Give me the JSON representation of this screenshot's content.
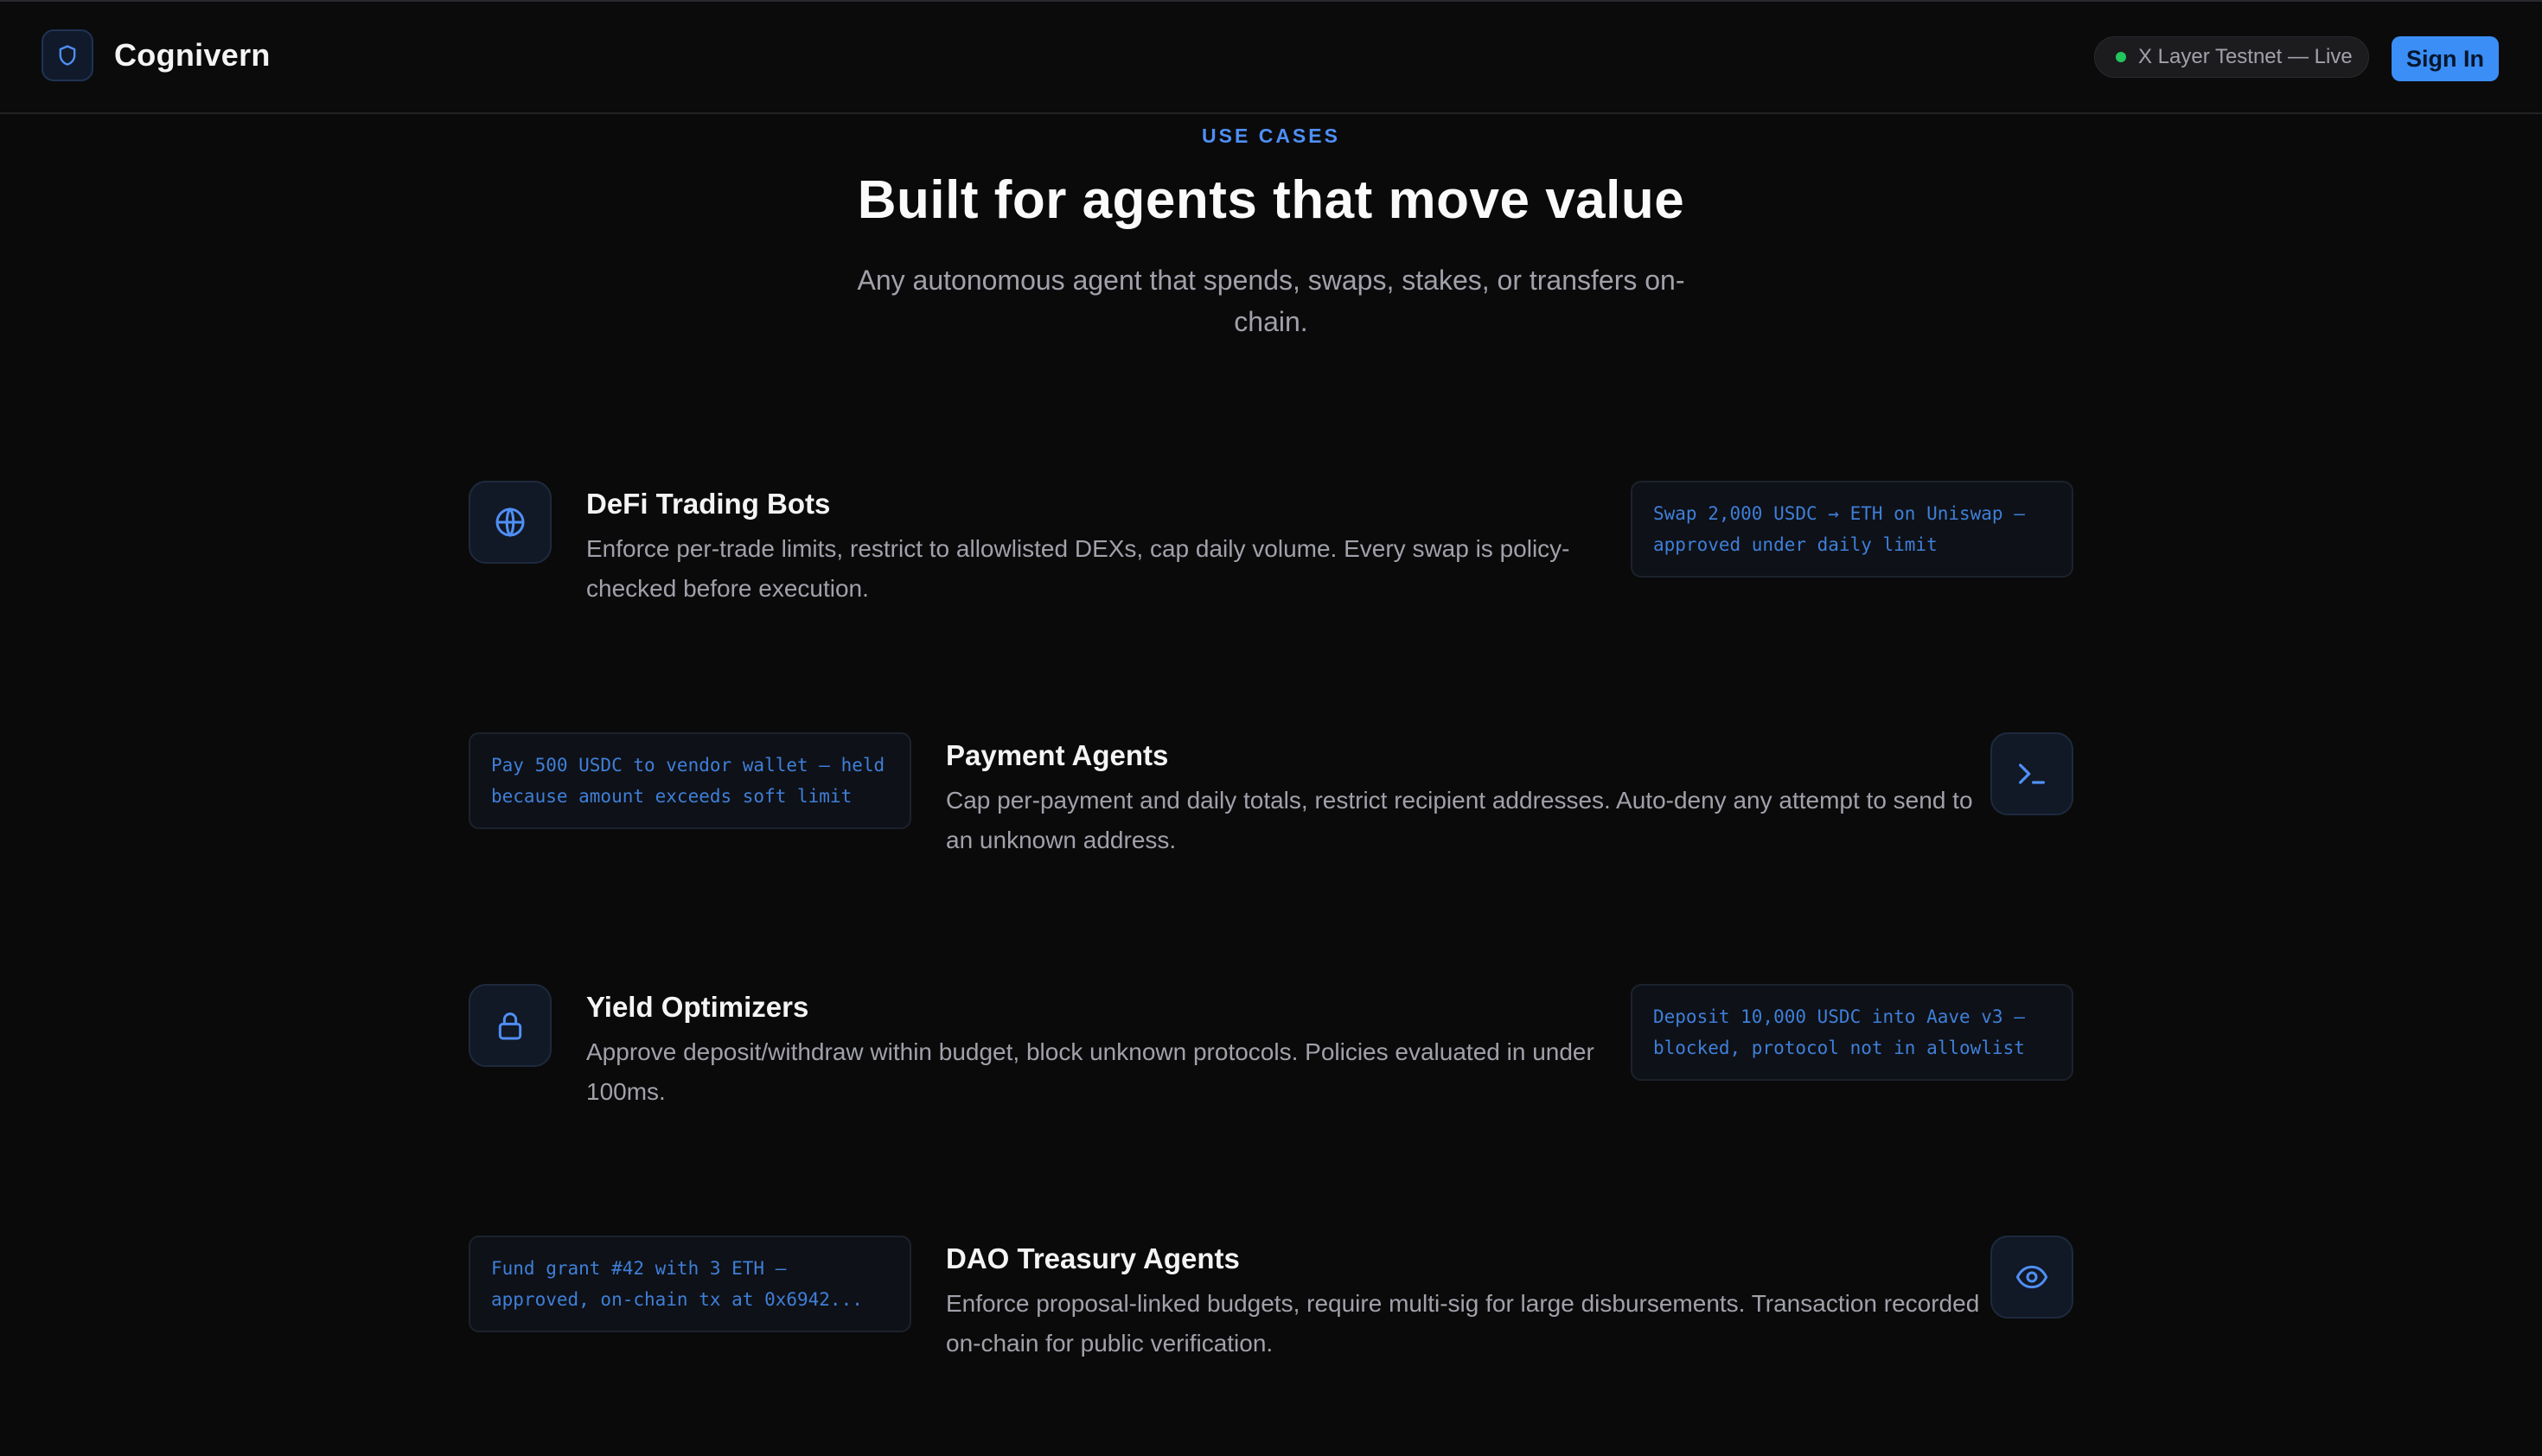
{
  "header": {
    "brand_name": "Cognivern",
    "logo_icon": "shield-icon",
    "network_status": "X Layer Testnet — Live",
    "status_color": "#22c55e",
    "signin_label": "Sign In",
    "accent_color": "#3b8ef6"
  },
  "section": {
    "eyebrow": "USE CASES",
    "title": "Built for agents that move value",
    "subtitle": "Any autonomous agent that spends, swaps, stakes, or transfers on-chain."
  },
  "use_cases": [
    {
      "icon": "globe-icon",
      "title": "DeFi Trading Bots",
      "description": "Enforce per-trade limits, restrict to allowlisted DEXs, cap daily volume. Every swap is policy-checked before execution.",
      "example": "Swap 2,000 USDC → ETH on Uniswap — approved under daily limit"
    },
    {
      "icon": "terminal-icon",
      "title": "Payment Agents",
      "description": "Cap per-payment and daily totals, restrict recipient addresses. Auto-deny any attempt to send to an unknown address.",
      "example": "Pay 500 USDC to vendor wallet — held because amount exceeds soft limit"
    },
    {
      "icon": "lock-icon",
      "title": "Yield Optimizers",
      "description": "Approve deposit/withdraw within budget, block unknown protocols. Policies evaluated in under 100ms.",
      "example": "Deposit 10,000 USDC into Aave v3 — blocked, protocol not in allowlist"
    },
    {
      "icon": "eye-icon",
      "title": "DAO Treasury Agents",
      "description": "Enforce proposal-linked budgets, require multi-sig for large disbursements. Transaction recorded on-chain for public verification.",
      "example": "Fund grant #42 with 3 ETH — approved, on-chain tx at 0x6942..."
    }
  ]
}
